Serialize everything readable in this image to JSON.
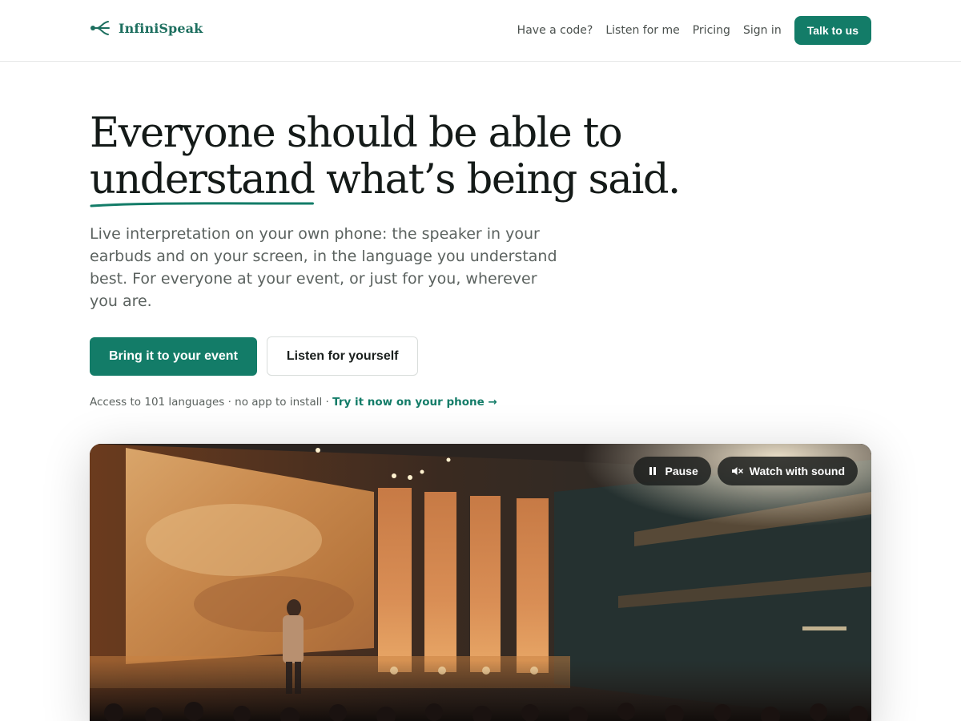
{
  "header": {
    "brand": "InfiniSpeak",
    "nav": [
      "Have a code?",
      "Listen for me",
      "Pricing",
      "Sign in"
    ],
    "cta": "Talk to us"
  },
  "hero": {
    "title_line1": "Everyone should be able to",
    "title_underlined": "understand",
    "title_line2_rest": " what’s being said.",
    "subtitle": "Live interpretation on your own phone: the speaker in your earbuds and on your screen, in the language you understand best. For everyone at your event, or just for you, wherever you are.",
    "primary_cta": "Bring it to your event",
    "secondary_cta": "Listen for yourself",
    "access_text": "Access to 101 languages · no app to install · ",
    "access_link": "Try it now on your phone →"
  },
  "video": {
    "pause_label": "Pause",
    "sound_label": "Watch with sound"
  },
  "colors": {
    "accent": "#137c68",
    "brand_text": "#1d6f5f"
  },
  "icons": {
    "logo": "branch-logo-icon",
    "pause": "pause-icon",
    "mute": "speaker-muted-icon"
  }
}
